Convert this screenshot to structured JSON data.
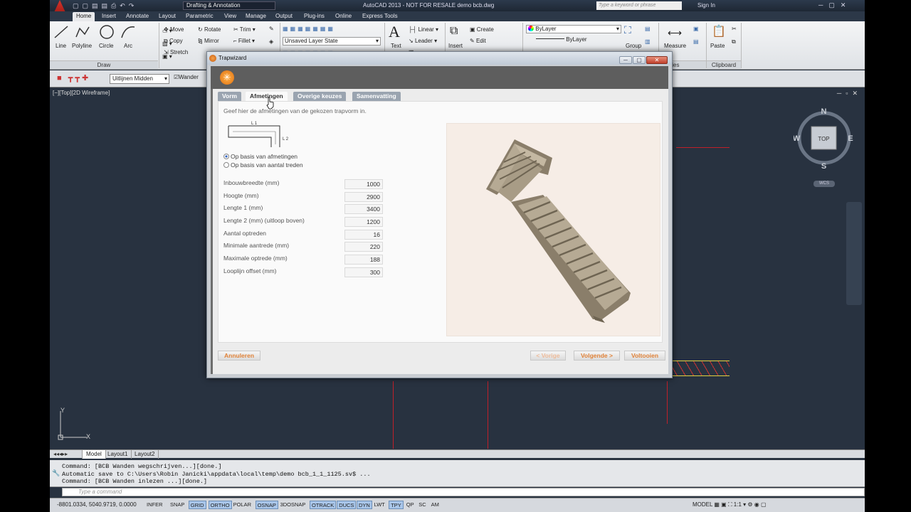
{
  "titlebar": {
    "workspace": "Drafting & Annotation",
    "app_title": "AutoCAD 2013 - NOT FOR RESALE   demo bcb.dwg",
    "search_placeholder": "Type a keyword or phrase",
    "sign_in": "Sign In"
  },
  "ribbon_tabs": [
    "Home",
    "Insert",
    "Annotate",
    "Layout",
    "Parametric",
    "View",
    "Manage",
    "Output",
    "Plug-ins",
    "Online",
    "Express Tools"
  ],
  "ribbon": {
    "draw": {
      "line": "Line",
      "polyline": "Polyline",
      "circle": "Circle",
      "arc": "Arc",
      "panel": "Draw"
    },
    "modify": {
      "move": "Move",
      "rotate": "Rotate",
      "trim": "Trim",
      "copy": "Copy",
      "mirror": "Mirror",
      "fillet": "Fillet",
      "stretch": "Stretch"
    },
    "layers": {
      "state": "Unsaved Layer State"
    },
    "annotation": {
      "text": "Text",
      "linear": "Linear",
      "leader": "Leader"
    },
    "block": {
      "insert": "Insert",
      "create": "Create",
      "edit": "Edit"
    },
    "properties": {
      "color": "ByLayer",
      "linetype": "ByLayer"
    },
    "groups": {
      "group": "Group"
    },
    "utilities": {
      "measure": "Measure"
    },
    "clipboard": {
      "paste": "Paste",
      "panel": "Clipboard"
    },
    "properties_panel_fragment": "ties"
  },
  "toolbar2": {
    "align_combo": "Uitlijnen Midden",
    "check_label": "Wander"
  },
  "viewport": {
    "label": "[−][Top][2D Wireframe]",
    "cube_top": "TOP",
    "north": "N",
    "south": "S",
    "east": "E",
    "west": "W",
    "wcs": "WCS",
    "ucs_x": "X",
    "ucs_y": "Y"
  },
  "layout_tabs": [
    "Model",
    "Layout1",
    "Layout2"
  ],
  "command_history": [
    "Command: [BCB Wanden wegschrijven...][done.]",
    "Automatic save to C:\\Users\\Robin Janicki\\appdata\\local\\temp\\demo bcb_1_1_1125.sv$ ...",
    "Command: [BCB Wanden inlezen ...][done.]"
  ],
  "command_placeholder": "Type a command",
  "status": {
    "coords": "-8801.0334, 5040.9719, 0.0000",
    "toggles": [
      {
        "label": "INFER",
        "on": false
      },
      {
        "label": "SNAP",
        "on": false
      },
      {
        "label": "GRID",
        "on": true
      },
      {
        "label": "ORTHO",
        "on": true
      },
      {
        "label": "POLAR",
        "on": false
      },
      {
        "label": "OSNAP",
        "on": true
      },
      {
        "label": "3DOSNAP",
        "on": false
      },
      {
        "label": "OTRACK",
        "on": true
      },
      {
        "label": "DUCS",
        "on": true
      },
      {
        "label": "DYN",
        "on": true
      },
      {
        "label": "LWT",
        "on": false
      },
      {
        "label": "TPY",
        "on": true
      },
      {
        "label": "QP",
        "on": false
      },
      {
        "label": "SC",
        "on": false
      },
      {
        "label": "AM",
        "on": false
      }
    ],
    "model": "MODEL",
    "scale": "1:1"
  },
  "dialog": {
    "title": "Trapwizard",
    "tabs": [
      "Vorm",
      "Afmetingen",
      "Overige keuzes",
      "Samenvatting"
    ],
    "active_tab": 1,
    "instruction": "Geef hier de afmetingen van de gekozen trapvorm in.",
    "diagram_l1": "L 1",
    "diagram_l2": "L 2",
    "radio_1": "Op basis van afmetingen",
    "radio_2": "Op basis van aantal treden",
    "fields": [
      {
        "label": "Inbouwbreedte (mm)",
        "value": "1000"
      },
      {
        "label": "Hoogte (mm)",
        "value": "2900"
      },
      {
        "label": "Lengte 1 (mm)",
        "value": "3400"
      },
      {
        "label": "Lengte 2 (mm) (uitloop boven)",
        "value": "1200"
      },
      {
        "label": "Aantal optreden",
        "value": "16"
      },
      {
        "label": "Minimale aantrede (mm)",
        "value": "220"
      },
      {
        "label": "Maximale optrede (mm)",
        "value": "188"
      },
      {
        "label": "Looplijn offset (mm)",
        "value": "300"
      }
    ],
    "cancel": "Annuleren",
    "prev": "< Vorige",
    "next": "Volgende >",
    "finish": "Voltooien"
  }
}
